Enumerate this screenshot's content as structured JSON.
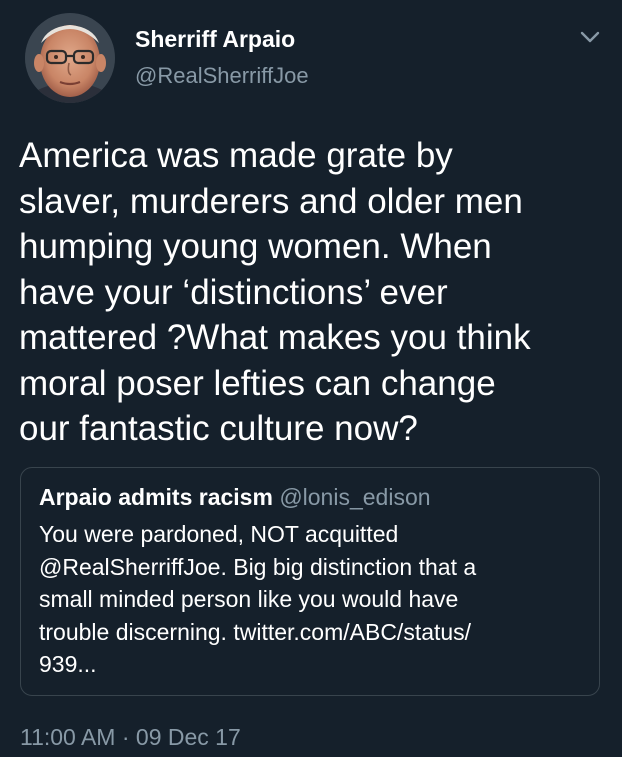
{
  "tweet": {
    "author": {
      "display_name": "Sherriff Arpaio",
      "handle": "@RealSherriffJoe",
      "avatar_icon": "profile-photo"
    },
    "menu_icon": "chevron-down-icon",
    "text": "America was made grate by\nslaver, murderers and older men\nhumping young women. When\nhave your ‘distinctions’ ever\nmattered ?What makes you think\nmoral poser lefties can change\nour fantastic culture now?",
    "quoted_tweet": {
      "display_name": "Arpaio admits racism",
      "handle": "@lonis_edison",
      "text": "You were pardoned, NOT acquitted\n@RealSherriffJoe. Big big distinction that a\nsmall minded person like you would have\ntrouble discerning. twitter.com/ABC/status/\n939..."
    },
    "timestamp": "11:00 AM · 09 Dec 17"
  },
  "colors": {
    "background": "#15202b",
    "primary_text": "#ffffff",
    "secondary_text": "#8899a6",
    "border": "#38444d"
  }
}
